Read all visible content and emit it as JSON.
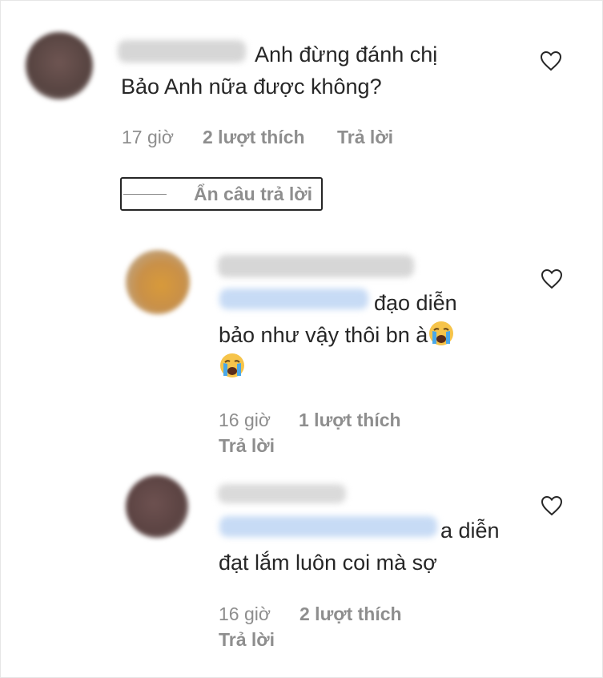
{
  "comments": [
    {
      "text_line1": "Anh đừng đánh chị",
      "text_line2": "Bảo Anh nữa được không?",
      "time": "17 giờ",
      "likes": "2 lượt thích",
      "reply": "Trả lời"
    },
    {
      "text_line1": "đạo diễn",
      "text_line2": "bảo như vậy thôi bn à",
      "time": "16 giờ",
      "likes": "1 lượt thích",
      "reply": "Trả lời"
    },
    {
      "text_line1": "a diễn",
      "text_line2": "đạt lắm luôn coi mà sợ",
      "time": "16 giờ",
      "likes": "2 lượt thích",
      "reply": "Trả lời"
    }
  ],
  "hide_replies_label": "Ẩn câu trả lời",
  "icons": {
    "like": "heart-outline-icon",
    "emoji": "crying-face-emoji"
  },
  "colors": {
    "text": "#262626",
    "meta": "#8e8e8e",
    "mention_blur": "#c7dbf5"
  }
}
